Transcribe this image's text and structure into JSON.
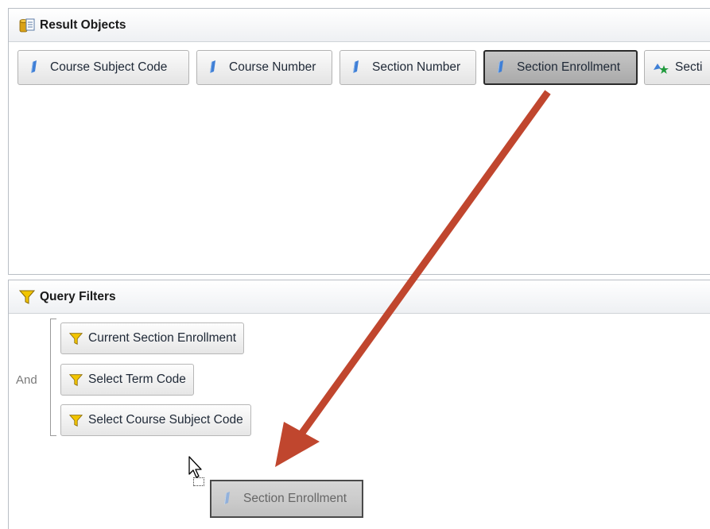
{
  "result_objects": {
    "title": "Result Objects",
    "items": [
      {
        "label": "Course Subject Code",
        "selected": false,
        "icon": "dimension-icon"
      },
      {
        "label": "Course Number",
        "selected": false,
        "icon": "dimension-icon"
      },
      {
        "label": "Section Number",
        "selected": false,
        "icon": "dimension-icon"
      },
      {
        "label": "Section Enrollment",
        "selected": true,
        "icon": "dimension-icon"
      },
      {
        "label": "Secti",
        "selected": false,
        "icon": "measure-star-icon"
      }
    ]
  },
  "query_filters": {
    "title": "Query Filters",
    "operator": "And",
    "items": [
      {
        "label": "Current Section Enrollment",
        "icon": "filter-funnel-icon"
      },
      {
        "label": "Select Term Code",
        "icon": "filter-funnel-icon"
      },
      {
        "label": "Select Course Subject Code",
        "icon": "filter-funnel-icon"
      }
    ]
  },
  "drag_ghost": {
    "label": "Section Enrollment"
  },
  "annotation": {
    "arrow_color": "#c0462e"
  },
  "colors": {
    "dimension_blue": "#3f7fd6",
    "funnel_yellow": "#f2c500"
  }
}
